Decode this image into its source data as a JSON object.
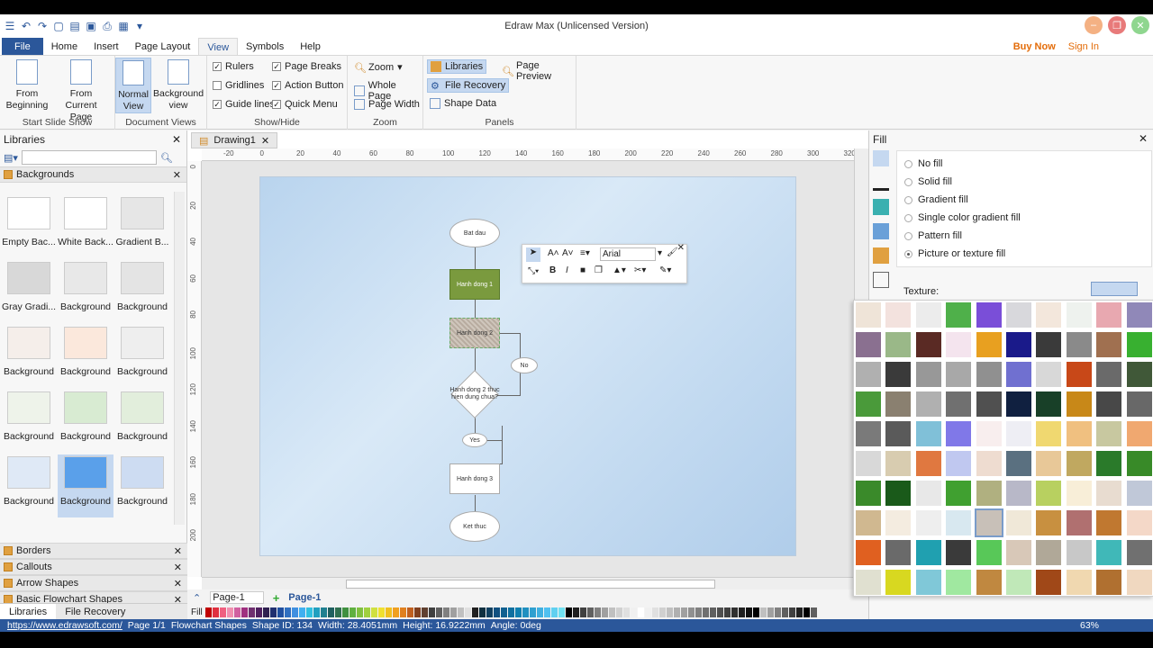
{
  "app": {
    "title": "Edraw Max (Unlicensed Version)",
    "buy_now": "Buy Now",
    "sign_in": "Sign In"
  },
  "menu": {
    "items": [
      "File",
      "Home",
      "Insert",
      "Page Layout",
      "View",
      "Symbols",
      "Help"
    ],
    "active": "View"
  },
  "ribbon": {
    "groups": {
      "start_slide_show": "Start Slide Show",
      "document_views": "Document Views",
      "show_hide": "Show/Hide",
      "zoom": "Zoom",
      "panels": "Panels"
    },
    "from_beginning": "From Beginning",
    "from_current_page": "From Current Page",
    "normal_view": "Normal View",
    "background_view": "Background view",
    "rulers": "Rulers",
    "gridlines": "Gridlines",
    "guide_lines": "Guide lines",
    "page_breaks": "Page Breaks",
    "action_button": "Action Button",
    "quick_menu": "Quick Menu",
    "zoom": "Zoom",
    "whole_page": "Whole Page",
    "page_width": "Page Width",
    "libraries": "Libraries",
    "file_recovery": "File Recovery",
    "shape_data": "Shape Data",
    "page_preview": "Page Preview"
  },
  "libraries": {
    "title": "Libraries",
    "category": "Backgrounds",
    "shapes": [
      {
        "label": "Empty Bac...",
        "c": "#ffffff"
      },
      {
        "label": "White Back...",
        "c": "#ffffff"
      },
      {
        "label": "Gradient B...",
        "c": "#e6e6e6"
      },
      {
        "label": "Gray Gradi...",
        "c": "#d8d8d8"
      },
      {
        "label": "Background",
        "c": "#e8e8e8"
      },
      {
        "label": "Background",
        "c": "#e4e4e4"
      },
      {
        "label": "Background",
        "c": "#f5eeea"
      },
      {
        "label": "Background",
        "c": "#fbe8dc"
      },
      {
        "label": "Background",
        "c": "#eeeeee"
      },
      {
        "label": "Background",
        "c": "#eef3ea"
      },
      {
        "label": "Background",
        "c": "#d8ebd2"
      },
      {
        "label": "Background",
        "c": "#e2eedc"
      },
      {
        "label": "Background",
        "c": "#dfe9f6"
      },
      {
        "label": "Background",
        "c": "#5aa0ea"
      },
      {
        "label": "Background",
        "c": "#cddcf2"
      }
    ],
    "collapsed": [
      "Borders",
      "Callouts",
      "Arrow Shapes",
      "Basic Flowchart Shapes"
    ],
    "bottom_tabs": [
      "Libraries",
      "File Recovery"
    ]
  },
  "document": {
    "tab": "Drawing1",
    "ruler_h": [
      "-20",
      "0",
      "20",
      "40",
      "60",
      "80",
      "100",
      "120",
      "140",
      "160",
      "180",
      "200",
      "220",
      "240",
      "260",
      "280",
      "300",
      "320"
    ],
    "ruler_v": [
      "0",
      "20",
      "40",
      "60",
      "80",
      "100",
      "120",
      "140",
      "160",
      "180",
      "200"
    ],
    "flow": {
      "start": "Bat dau",
      "action1": "Hanh dong 1",
      "action2": "Hanh dong 2",
      "decision": "Hanh dong 2 thuc hien dung chua?",
      "no": "No",
      "yes": "Yes",
      "action3": "Hanh dong 3",
      "end": "Ket thuc"
    },
    "font": "Arial",
    "page_select": "Page-1",
    "page_tab": "Page-1",
    "fill_label": "Fill"
  },
  "fill": {
    "title": "Fill",
    "options": [
      "No fill",
      "Solid fill",
      "Gradient fill",
      "Single color gradient fill",
      "Pattern fill",
      "Picture or texture fill"
    ],
    "selected": "Picture or texture fill",
    "texture_label": "Texture:"
  },
  "status": {
    "url": "https://www.edrawsoft.com/",
    "page": "Page 1/1",
    "shapes": "Flowchart Shapes",
    "shape_id": "Shape ID: 134",
    "width": "Width: 28.4051mm",
    "height": "Height: 16.9222mm",
    "angle": "Angle: 0deg",
    "zoom": "63%"
  },
  "colors": {
    "accent": "#2b579a",
    "highlight": "#c5d8f0"
  }
}
